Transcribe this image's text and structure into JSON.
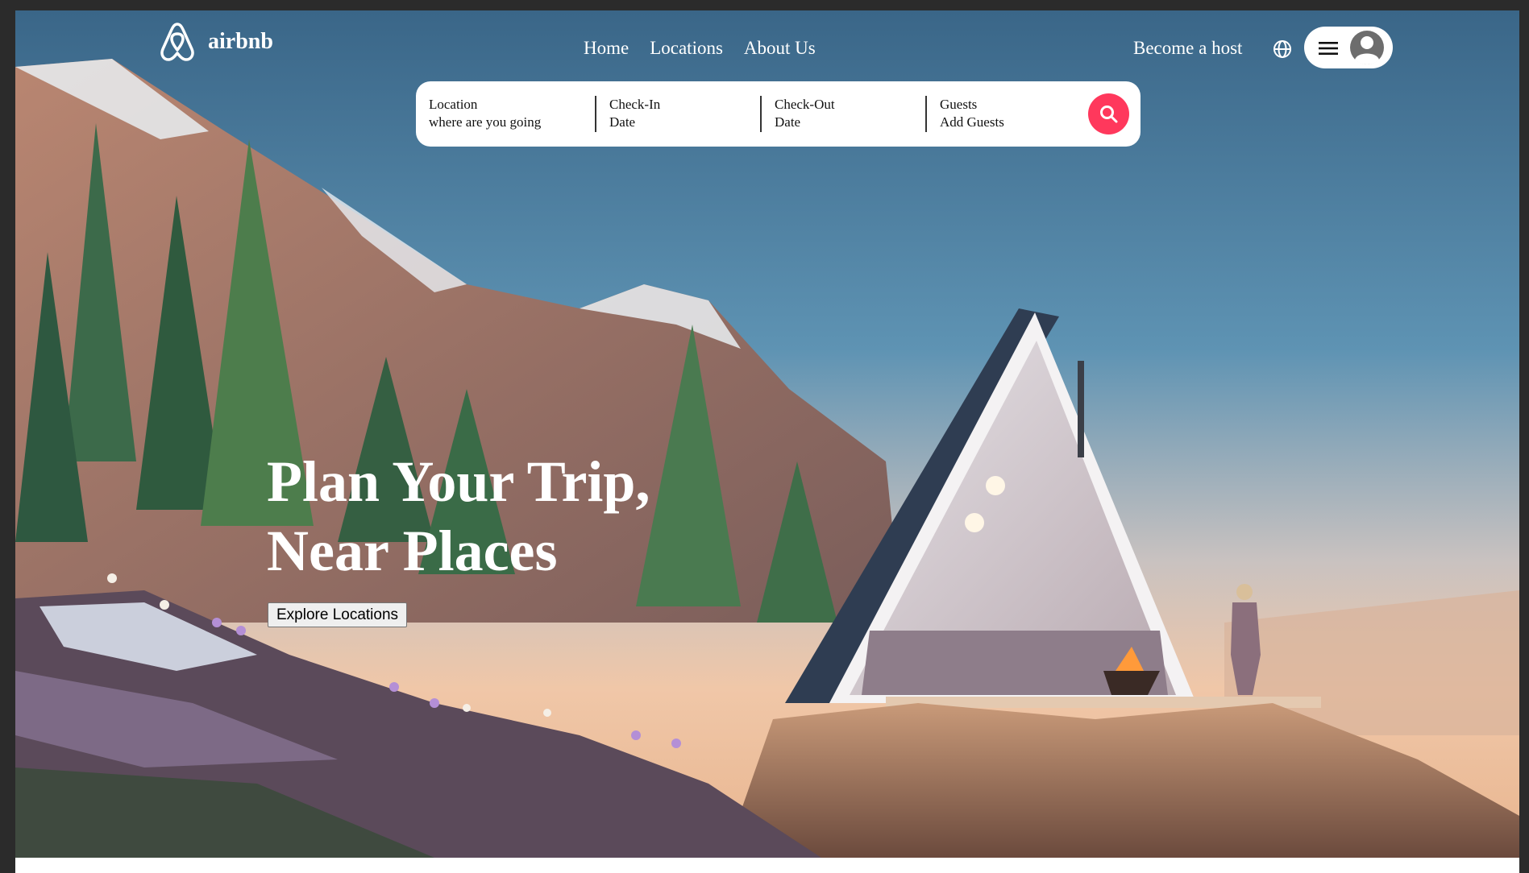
{
  "header": {
    "brand": "airbnb",
    "nav": [
      "Home",
      "Locations",
      "About Us"
    ],
    "host_link": "Become a host"
  },
  "search": {
    "fields": [
      {
        "title": "Location",
        "sub": "where are you going"
      },
      {
        "title": "Check-In",
        "sub": "Date"
      },
      {
        "title": "Check-Out",
        "sub": "Date"
      },
      {
        "title": "Guests",
        "sub": "Add Guests"
      }
    ]
  },
  "hero": {
    "line1": "Plan Your Trip,",
    "line2": "Near Places",
    "cta": "Explore Locations"
  },
  "colors": {
    "accent": "#ff385c",
    "text_light": "#ffffff"
  },
  "icons": [
    "airbnb-logo-icon",
    "globe-icon",
    "hamburger-menu-icon",
    "user-avatar-icon",
    "search-icon"
  ]
}
